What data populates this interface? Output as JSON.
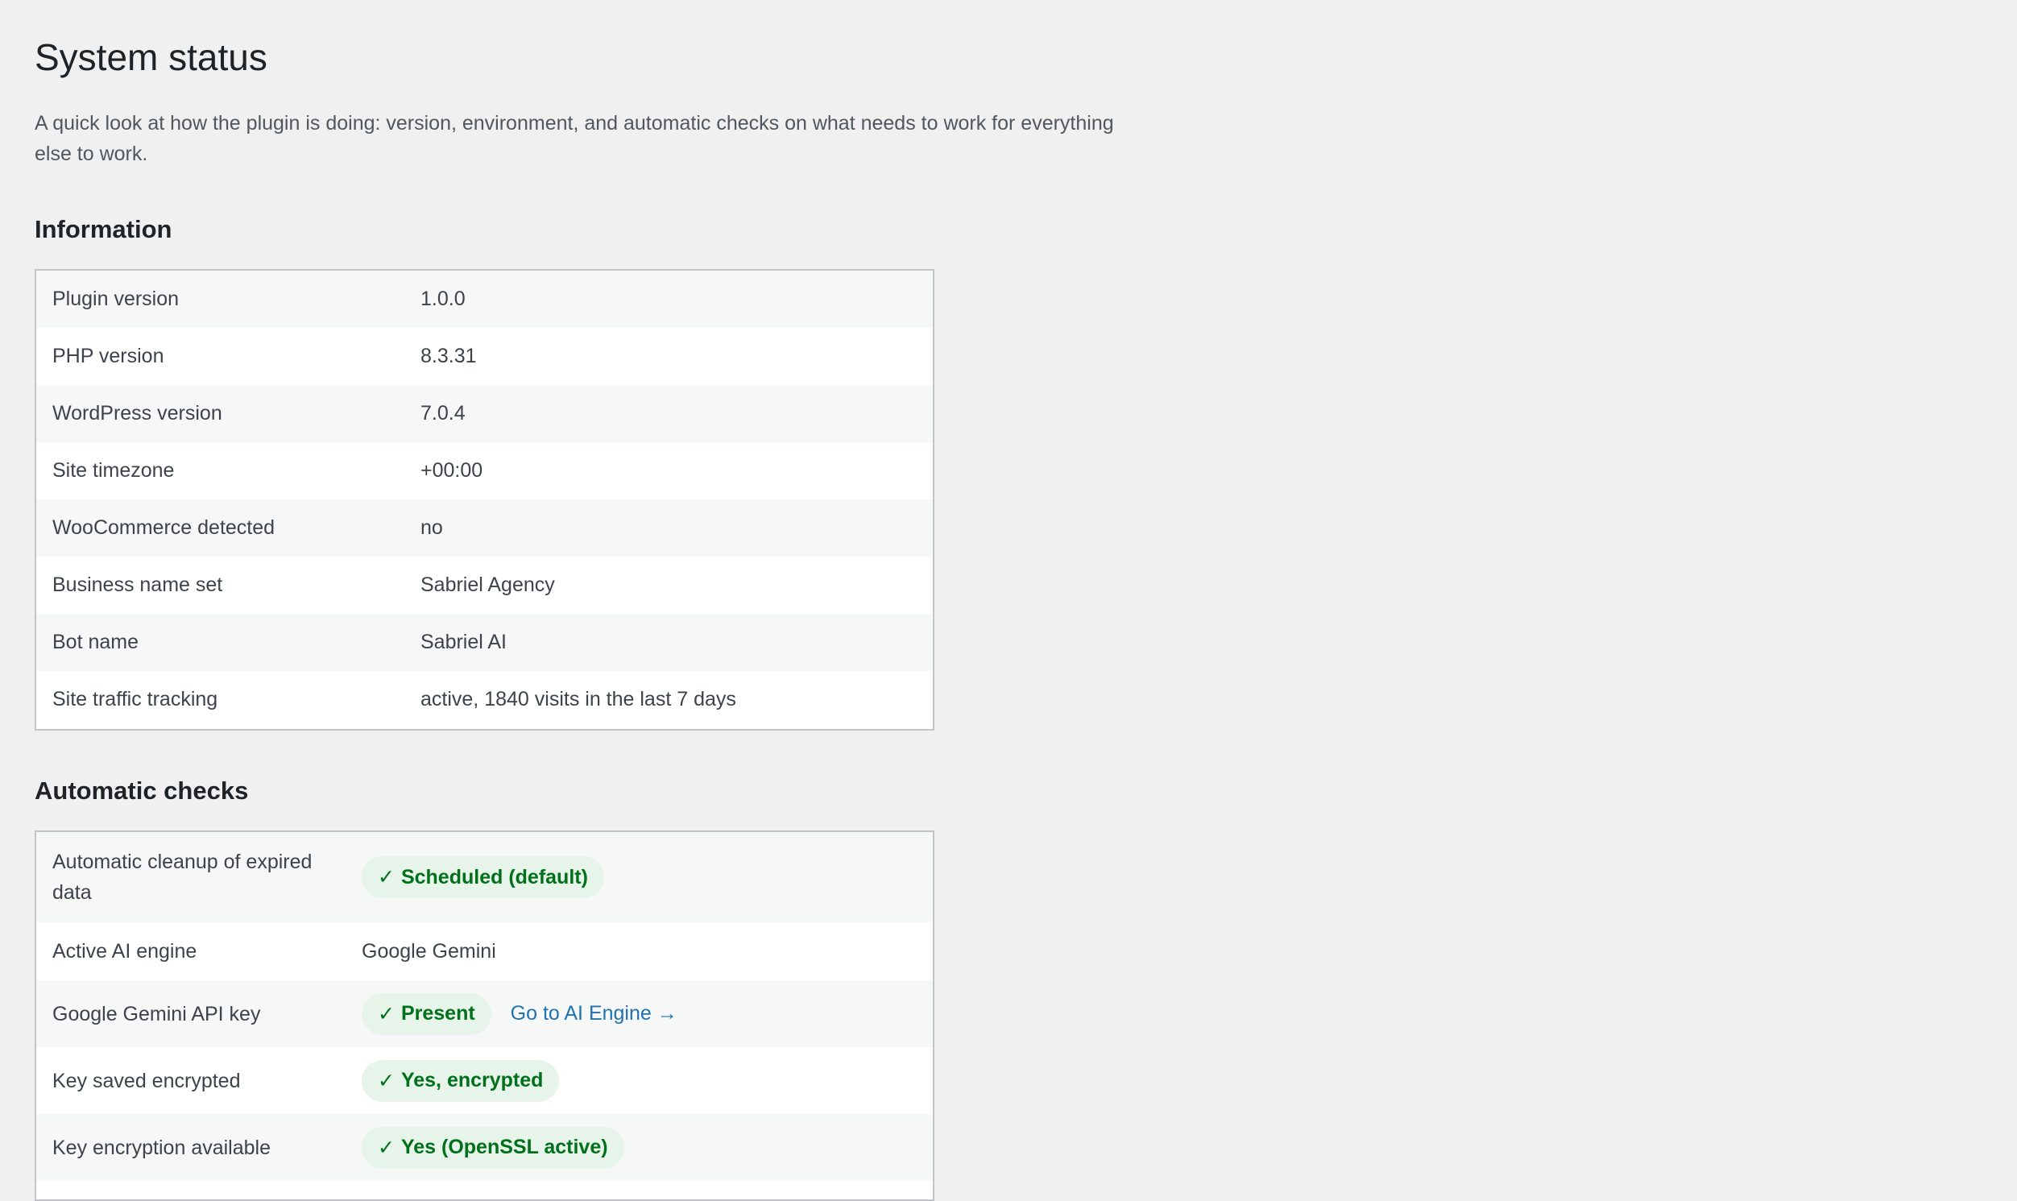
{
  "page": {
    "title": "System status",
    "intro": "A quick look at how the plugin is doing: version, environment, and automatic checks on what needs to work for everything else to work."
  },
  "information": {
    "heading": "Information",
    "rows": [
      {
        "label": "Plugin version",
        "value": "1.0.0"
      },
      {
        "label": "PHP version",
        "value": "8.3.31"
      },
      {
        "label": "WordPress version",
        "value": "7.0.4"
      },
      {
        "label": "Site timezone",
        "value": "+00:00"
      },
      {
        "label": "WooCommerce detected",
        "value": "no"
      },
      {
        "label": "Business name set",
        "value": "Sabriel Agency"
      },
      {
        "label": "Bot name",
        "value": "Sabriel AI"
      },
      {
        "label": "Site traffic tracking",
        "value": "active, 1840 visits in the last 7 days"
      }
    ]
  },
  "checks": {
    "heading": "Automatic checks",
    "check_glyph": "✓",
    "rows": [
      {
        "label": "Automatic cleanup of expired data",
        "badge": "Scheduled (default)"
      },
      {
        "label": "Active AI engine",
        "value": "Google Gemini"
      },
      {
        "label": "Google Gemini API key",
        "badge": "Present",
        "link": "Go to AI Engine →"
      },
      {
        "label": "Key saved encrypted",
        "badge": "Yes, encrypted"
      },
      {
        "label": "Key encryption available",
        "badge": "Yes (OpenSSL active)"
      }
    ]
  },
  "colors": {
    "background": "#f0f0f1",
    "badge_bg": "#e6f4ea",
    "badge_text": "#00701a",
    "link": "#2271b1",
    "border": "#c3c4c7"
  }
}
